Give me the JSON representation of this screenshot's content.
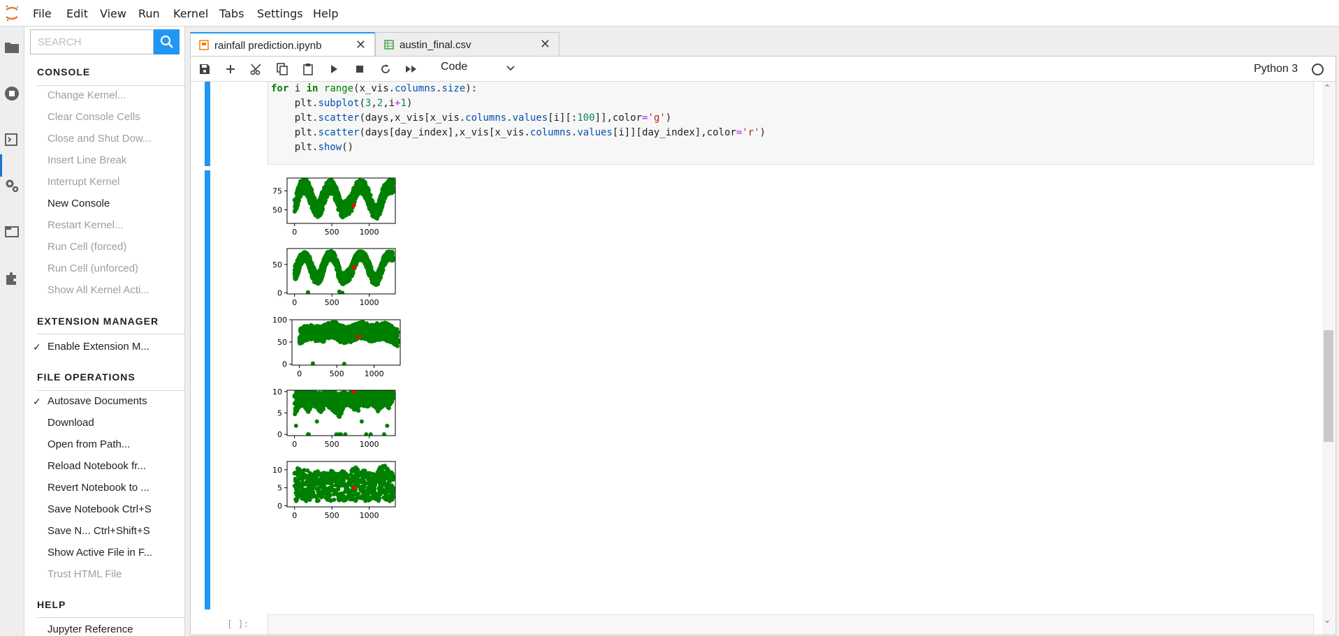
{
  "menubar": {
    "items": [
      "File",
      "Edit",
      "View",
      "Run",
      "Kernel",
      "Tabs",
      "Settings",
      "Help"
    ]
  },
  "activity_icons": [
    "folder-icon",
    "running-icon",
    "commands-icon",
    "settings-icon",
    "tabs-icon",
    "extensions-icon"
  ],
  "palette": {
    "search_placeholder": "SEARCH",
    "sections": [
      {
        "title": "CONSOLE",
        "items": [
          {
            "label": "Change Kernel...",
            "enabled": false,
            "checked": false
          },
          {
            "label": "Clear Console Cells",
            "enabled": false,
            "checked": false
          },
          {
            "label": "Close and Shut Dow...",
            "enabled": false,
            "checked": false
          },
          {
            "label": "Insert Line Break",
            "enabled": false,
            "checked": false
          },
          {
            "label": "Interrupt Kernel",
            "enabled": false,
            "checked": false
          },
          {
            "label": "New Console",
            "enabled": true,
            "checked": false
          },
          {
            "label": "Restart Kernel...",
            "enabled": false,
            "checked": false
          },
          {
            "label": "Run Cell (forced)",
            "enabled": false,
            "checked": false
          },
          {
            "label": "Run Cell (unforced)",
            "enabled": false,
            "checked": false
          },
          {
            "label": "Show All Kernel Acti...",
            "enabled": false,
            "checked": false
          }
        ]
      },
      {
        "title": "EXTENSION MANAGER",
        "items": [
          {
            "label": "Enable Extension M...",
            "enabled": true,
            "checked": true
          }
        ]
      },
      {
        "title": "FILE OPERATIONS",
        "items": [
          {
            "label": "Autosave Documents",
            "enabled": true,
            "checked": true
          },
          {
            "label": "Download",
            "enabled": true,
            "checked": false
          },
          {
            "label": "Open from Path...",
            "enabled": true,
            "checked": false
          },
          {
            "label": "Reload Notebook fr...",
            "enabled": true,
            "checked": false
          },
          {
            "label": "Revert Notebook to ...",
            "enabled": true,
            "checked": false
          },
          {
            "label": "Save Notebook Ctrl+S",
            "enabled": true,
            "checked": false
          },
          {
            "label": "Save N...   Ctrl+Shift+S",
            "enabled": true,
            "checked": false
          },
          {
            "label": "Show Active File in F...",
            "enabled": true,
            "checked": false
          },
          {
            "label": "Trust HTML File",
            "enabled": false,
            "checked": false
          }
        ]
      },
      {
        "title": "HELP",
        "items": [
          {
            "label": "Jupyter Reference",
            "enabled": true,
            "checked": false
          }
        ]
      }
    ]
  },
  "tabs": [
    {
      "label": "rainfall prediction.ipynb",
      "icon": "notebook-icon",
      "active": true
    },
    {
      "label": "austin_final.csv",
      "icon": "spreadsheet-icon",
      "active": false
    }
  ],
  "toolbar": {
    "buttons": [
      "save-icon",
      "add-icon",
      "cut-icon",
      "copy-icon",
      "paste-icon",
      "run-icon",
      "stop-icon",
      "restart-icon",
      "fast-forward-icon"
    ],
    "cell_type": "Code",
    "kernel_name": "Python 3"
  },
  "code_lines": [
    "for i in range(x_vis.columns.size):",
    "    plt.subplot(3,2,i+1)",
    "    plt.scatter(days,x_vis[x_vis.columns.values[i][:100]],color='g')",
    "    plt.scatter(days[day_index],x_vis[x_vis.columns.values[i]][day_index],color='r')",
    "    plt.show()"
  ],
  "empty_prompt": "[ ]:",
  "colors": {
    "accent": "#2196f3",
    "series_green": "#008000",
    "series_red": "#ff0000"
  },
  "chart_data": [
    {
      "type": "scatter",
      "xlim": [
        -100,
        1350
      ],
      "ylim": [
        32,
        92
      ],
      "xticks": [
        0,
        500,
        1000
      ],
      "yticks": [
        50,
        75
      ],
      "series": [
        {
          "color": "green",
          "band": [
            [
              0,
              40,
              65
            ],
            [
              40,
              55,
              78
            ],
            [
              80,
              68,
              88
            ],
            [
              120,
              72,
              90
            ],
            [
              160,
              70,
              90
            ],
            [
              200,
              60,
              85
            ],
            [
              240,
              50,
              75
            ],
            [
              280,
              42,
              62
            ],
            [
              320,
              40,
              60
            ],
            [
              360,
              45,
              72
            ],
            [
              400,
              58,
              82
            ],
            [
              440,
              68,
              88
            ],
            [
              480,
              72,
              90
            ],
            [
              520,
              70,
              88
            ],
            [
              560,
              58,
              80
            ],
            [
              600,
              45,
              68
            ],
            [
              640,
              40,
              60
            ],
            [
              680,
              40,
              62
            ],
            [
              720,
              44,
              66
            ],
            [
              760,
              45,
              70
            ],
            [
              800,
              58,
              82
            ],
            [
              840,
              70,
              88
            ],
            [
              880,
              72,
              90
            ],
            [
              920,
              70,
              90
            ],
            [
              960,
              62,
              85
            ],
            [
              1000,
              52,
              76
            ],
            [
              1040,
              42,
              62
            ],
            [
              1080,
              36,
              55
            ],
            [
              1120,
              38,
              58
            ],
            [
              1160,
              48,
              72
            ],
            [
              1200,
              62,
              84
            ],
            [
              1240,
              70,
              88
            ],
            [
              1280,
              72,
              90
            ],
            [
              1320,
              72,
              90
            ]
          ]
        },
        {
          "color": "red",
          "points": [
            [
              796,
              56
            ]
          ]
        }
      ]
    },
    {
      "type": "scatter",
      "xlim": [
        -100,
        1350
      ],
      "ylim": [
        -2,
        78
      ],
      "xticks": [
        0,
        500,
        1000
      ],
      "yticks": [
        0,
        50
      ],
      "series": [
        {
          "color": "green",
          "band": [
            [
              0,
              18,
              45
            ],
            [
              40,
              30,
              58
            ],
            [
              80,
              48,
              68
            ],
            [
              120,
              55,
              72
            ],
            [
              160,
              55,
              72
            ],
            [
              200,
              42,
              65
            ],
            [
              240,
              25,
              50
            ],
            [
              280,
              15,
              38
            ],
            [
              320,
              15,
              35
            ],
            [
              360,
              22,
              48
            ],
            [
              400,
              40,
              62
            ],
            [
              440,
              55,
              72
            ],
            [
              480,
              58,
              74
            ],
            [
              520,
              55,
              72
            ],
            [
              560,
              40,
              62
            ],
            [
              600,
              22,
              45
            ],
            [
              640,
              15,
              35
            ],
            [
              680,
              15,
              36
            ],
            [
              720,
              20,
              42
            ],
            [
              760,
              25,
              48
            ],
            [
              800,
              40,
              62
            ],
            [
              840,
              55,
              72
            ],
            [
              880,
              58,
              74
            ],
            [
              920,
              56,
              72
            ],
            [
              960,
              45,
              68
            ],
            [
              1000,
              30,
              55
            ],
            [
              1040,
              18,
              40
            ],
            [
              1080,
              12,
              32
            ],
            [
              1120,
              15,
              38
            ],
            [
              1160,
              28,
              52
            ],
            [
              1200,
              45,
              66
            ],
            [
              1240,
              56,
              72
            ],
            [
              1280,
              58,
              74
            ],
            [
              1320,
              56,
              72
            ]
          ],
          "outliers": [
            [
              180,
              1
            ],
            [
              600,
              2
            ],
            [
              640,
              0
            ]
          ]
        },
        {
          "color": "red",
          "points": [
            [
              796,
              45
            ]
          ]
        }
      ]
    },
    {
      "type": "scatter",
      "xlim": [
        -100,
        1350
      ],
      "ylim": [
        -2,
        100
      ],
      "xticks": [
        0,
        500,
        1000
      ],
      "yticks": [
        0,
        50,
        100
      ],
      "series": [
        {
          "color": "green",
          "band": [
            [
              0,
              45,
              80
            ],
            [
              60,
              50,
              85
            ],
            [
              120,
              55,
              88
            ],
            [
              180,
              55,
              90
            ],
            [
              240,
              50,
              88
            ],
            [
              300,
              48,
              85
            ],
            [
              360,
              55,
              92
            ],
            [
              420,
              60,
              95
            ],
            [
              480,
              58,
              95
            ],
            [
              540,
              50,
              92
            ],
            [
              600,
              45,
              85
            ],
            [
              660,
              48,
              88
            ],
            [
              720,
              52,
              90
            ],
            [
              780,
              55,
              92
            ],
            [
              840,
              58,
              95
            ],
            [
              900,
              55,
              92
            ],
            [
              960,
              50,
              90
            ],
            [
              1020,
              52,
              92
            ],
            [
              1080,
              55,
              95
            ],
            [
              1140,
              55,
              95
            ],
            [
              1200,
              50,
              90
            ],
            [
              1260,
              45,
              85
            ],
            [
              1320,
              40,
              78
            ]
          ],
          "outliers": [
            [
              180,
              2
            ],
            [
              600,
              1
            ]
          ]
        },
        {
          "color": "red",
          "points": [
            [
              796,
              62
            ]
          ]
        }
      ]
    },
    {
      "type": "scatter",
      "xlim": [
        -100,
        1350
      ],
      "ylim": [
        -0.3,
        10.3
      ],
      "xticks": [
        0,
        500,
        1000
      ],
      "yticks": [
        0,
        5,
        10
      ],
      "series": [
        {
          "color": "green",
          "band": [
            [
              0,
              4,
              10
            ],
            [
              60,
              6,
              10
            ],
            [
              120,
              7,
              10
            ],
            [
              180,
              5,
              10
            ],
            [
              240,
              7,
              10
            ],
            [
              300,
              6,
              10
            ],
            [
              360,
              5,
              10
            ],
            [
              420,
              7,
              10
            ],
            [
              480,
              6,
              10
            ],
            [
              540,
              5,
              10
            ],
            [
              600,
              4,
              10
            ],
            [
              660,
              6,
              10
            ],
            [
              720,
              7,
              10
            ],
            [
              780,
              6,
              10
            ],
            [
              840,
              5,
              10
            ],
            [
              900,
              7,
              10
            ],
            [
              960,
              6,
              10
            ],
            [
              1020,
              7,
              10
            ],
            [
              1080,
              6,
              10
            ],
            [
              1140,
              5,
              10
            ],
            [
              1200,
              7,
              10
            ],
            [
              1260,
              6,
              10
            ],
            [
              1320,
              7,
              10
            ]
          ],
          "outliers": [
            [
              20,
              2
            ],
            [
              180,
              0
            ],
            [
              190,
              0
            ],
            [
              560,
              0
            ],
            [
              600,
              0
            ],
            [
              620,
              0
            ],
            [
              680,
              0
            ],
            [
              960,
              0
            ],
            [
              1020,
              0
            ],
            [
              1200,
              0
            ],
            [
              1240,
              2
            ],
            [
              300,
              3
            ],
            [
              900,
              3
            ]
          ]
        },
        {
          "color": "red",
          "points": [
            [
              796,
              10
            ]
          ]
        }
      ]
    },
    {
      "type": "scatter",
      "xlim": [
        -100,
        1350
      ],
      "ylim": [
        -0.3,
        12.3
      ],
      "xticks": [
        0,
        500,
        1000
      ],
      "yticks": [
        0,
        5,
        10
      ],
      "series": [
        {
          "color": "green",
          "band": [
            [
              0,
              1,
              11
            ],
            [
              80,
              2,
              10
            ],
            [
              160,
              1,
              10
            ],
            [
              240,
              2,
              9
            ],
            [
              320,
              1,
              10
            ],
            [
              400,
              2,
              9
            ],
            [
              480,
              1,
              10
            ],
            [
              560,
              2,
              9
            ],
            [
              640,
              1,
              10
            ],
            [
              720,
              2,
              9
            ],
            [
              800,
              1,
              11
            ],
            [
              880,
              2,
              10
            ],
            [
              960,
              1,
              10
            ],
            [
              1040,
              2,
              9
            ],
            [
              1120,
              1,
              10
            ],
            [
              1200,
              2,
              12
            ],
            [
              1280,
              1,
              10
            ],
            [
              1320,
              2,
              9
            ]
          ]
        },
        {
          "color": "red",
          "points": [
            [
              796,
              5
            ]
          ]
        }
      ]
    }
  ]
}
